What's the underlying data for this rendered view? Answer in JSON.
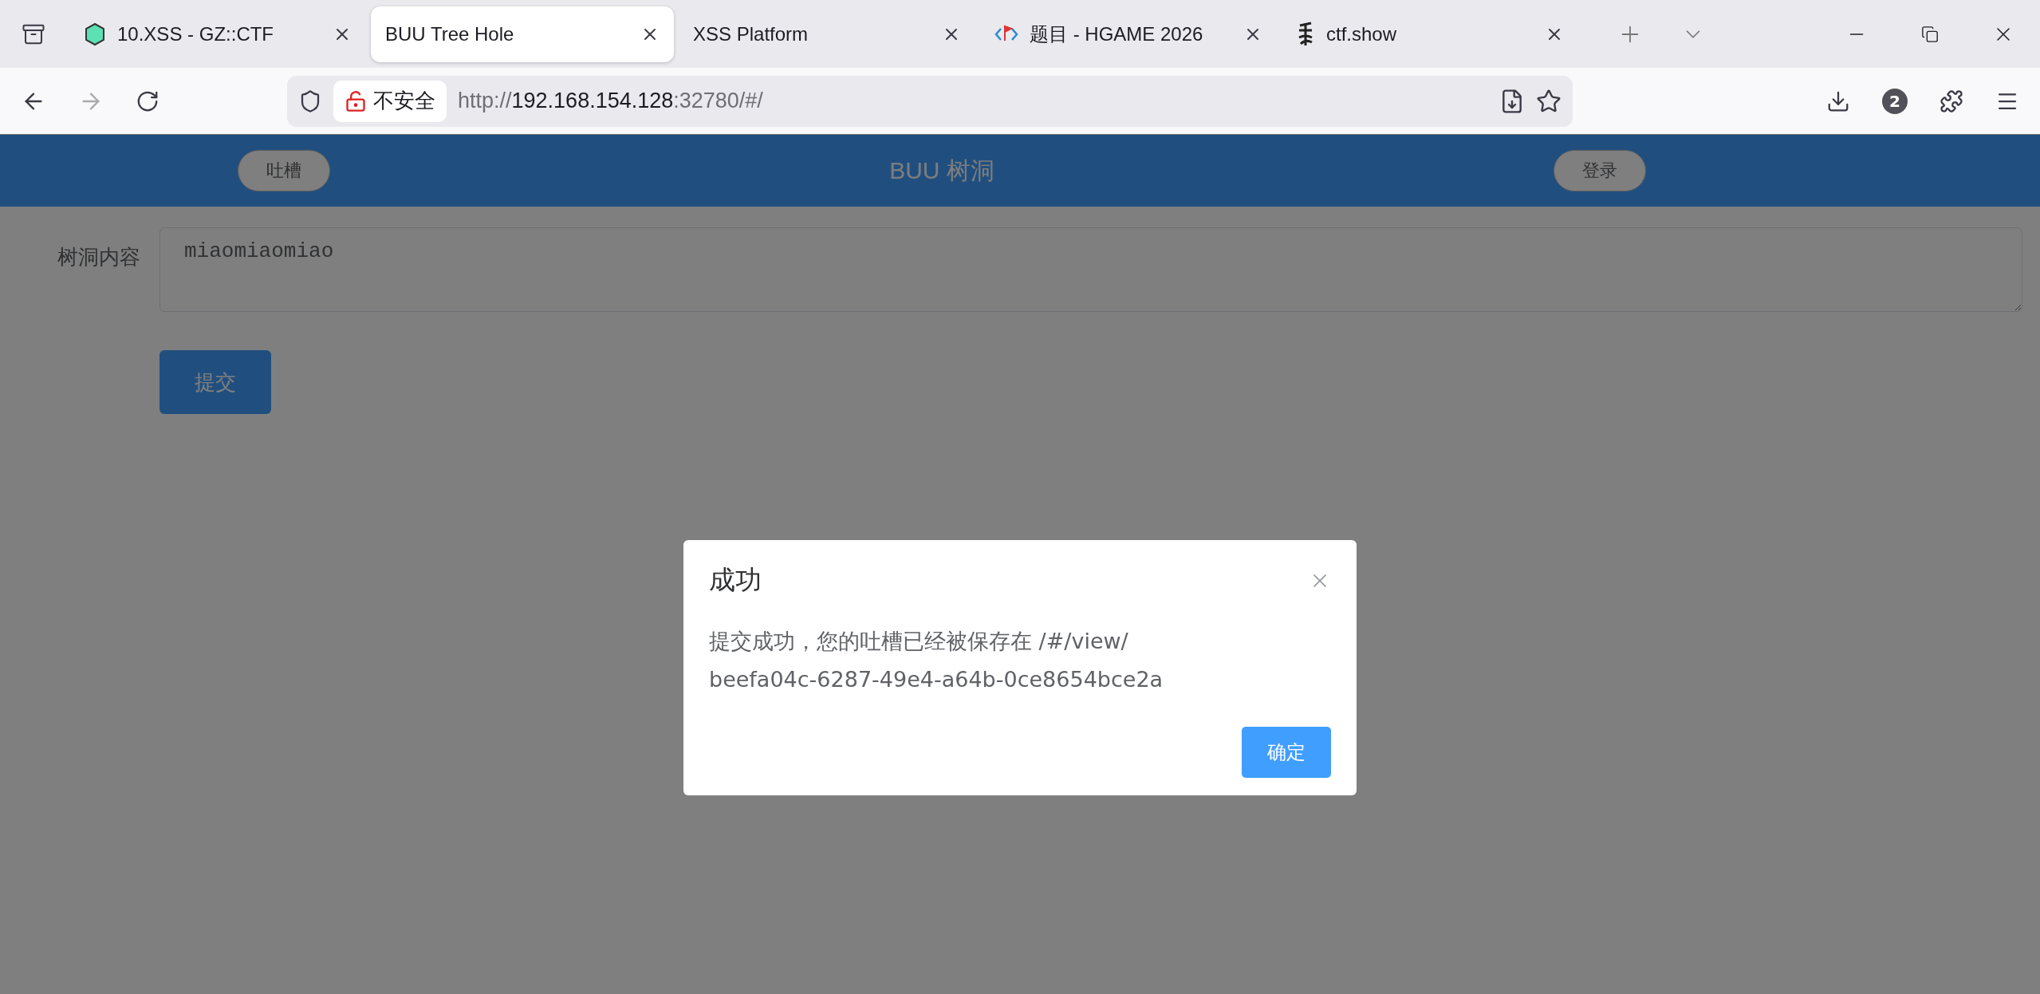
{
  "browser": {
    "tabs": [
      {
        "title": "10.XSS - GZ::CTF",
        "selected": false
      },
      {
        "title": "BUU Tree Hole",
        "selected": true
      },
      {
        "title": "XSS Platform",
        "selected": false
      },
      {
        "title": "题目 - HGAME 2026",
        "selected": false
      },
      {
        "title": "ctf.show",
        "selected": false
      }
    ],
    "security_label": "不安全",
    "url_scheme": "http://",
    "url_host": "192.168.154.128",
    "url_rest": ":32780/#/",
    "extensions_badge": "2"
  },
  "page": {
    "header": {
      "left_button": "吐槽",
      "title": "BUU 树洞",
      "right_button": "登录"
    },
    "form": {
      "label": "树洞内容",
      "value": "miaomiaomiao",
      "submit": "提交"
    }
  },
  "dialog": {
    "title": "成功",
    "message_lines": [
      "提交成功，您的吐槽已经被保存在 /#/view/",
      "beefa04c-6287-49e4-a64b-0ce8654bce2a"
    ],
    "confirm": "确定"
  }
}
